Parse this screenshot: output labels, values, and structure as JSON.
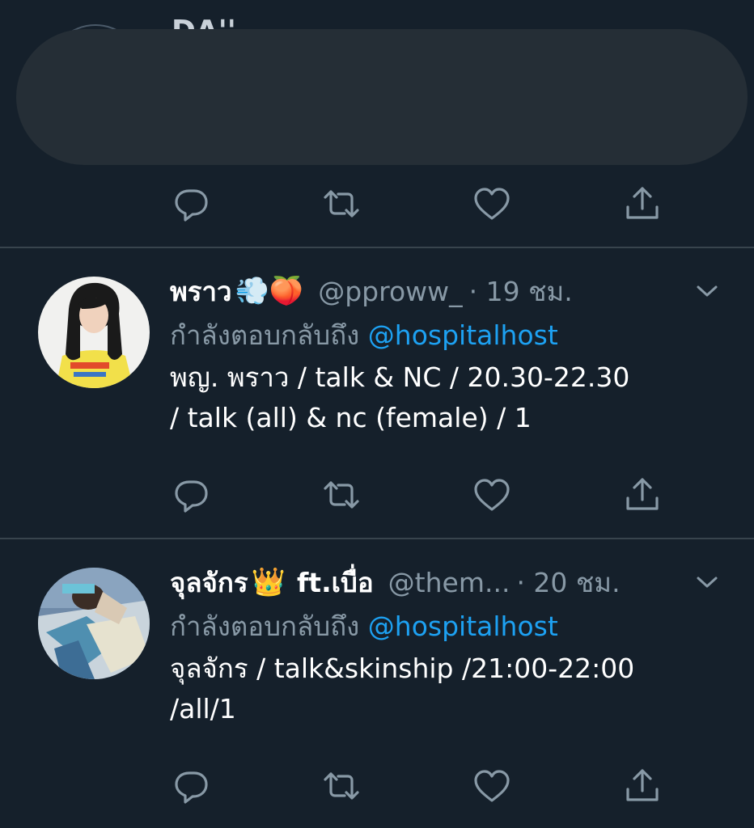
{
  "tweets": [
    {
      "redacted": true,
      "name_fragment": "DA''"
    },
    {
      "name": "พราว",
      "name_emojis": "💨🍑",
      "handle": "@pproww_",
      "time": "· 19 ชม.",
      "reply_prefix": "กำลังตอบกลับถึง",
      "reply_to": "@hospitalhost",
      "text_line1": "พญ. พราว / talk & NC / 20.30-22.30",
      "text_line2": "/ talk (all) & nc (female) / 1"
    },
    {
      "name": "จุลจักร",
      "name_emojis": "👑",
      "name_suffix": "ft.เบื่อ",
      "handle": "@them...",
      "time": "· 20 ชม.",
      "reply_prefix": "กำลังตอบกลับถึง",
      "reply_to": "@hospitalhost",
      "text_line1": "จุลจักร / talk&skinship /21:00-22:00",
      "text_line2": "/all/1"
    }
  ],
  "icons": {
    "reply": "reply-icon",
    "retweet": "retweet-icon",
    "like": "like-icon",
    "share": "share-icon",
    "more": "chevron-down-icon"
  },
  "colors": {
    "background": "#15202b",
    "divider": "#38444d",
    "secondary_text": "#8899a6",
    "mention": "#1da1f2",
    "redaction": "#252e36"
  }
}
